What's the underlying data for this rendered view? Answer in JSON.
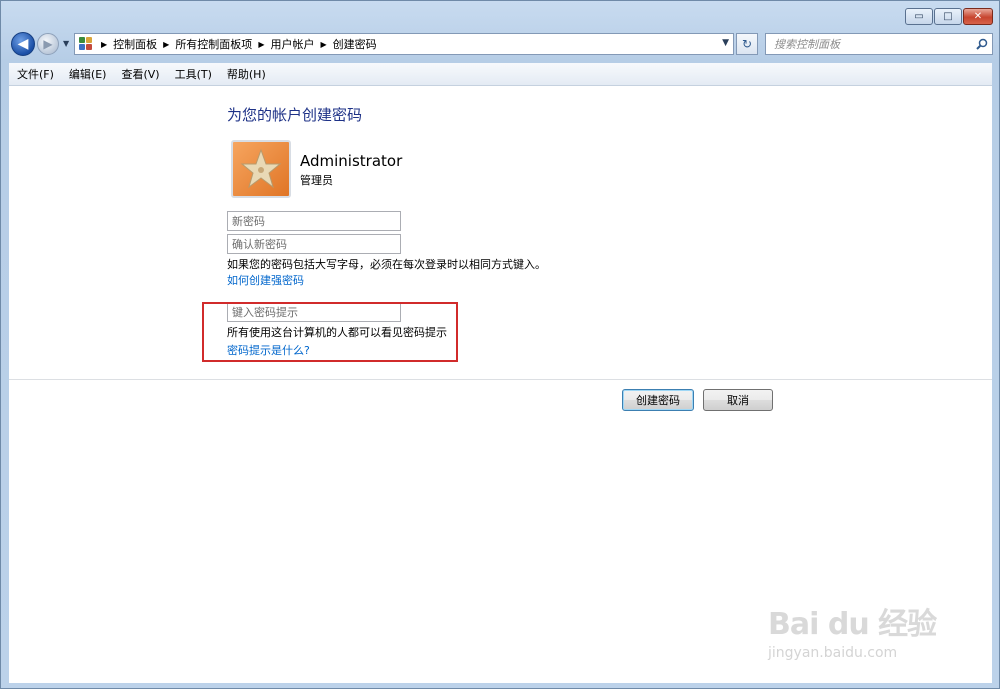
{
  "window": {
    "caption_buttons": {
      "minimize": "▭",
      "maximize": "□",
      "close": "✕"
    }
  },
  "address_bar": {
    "crumbs": [
      "控制面板",
      "所有控制面板项",
      "用户帐户",
      "创建密码"
    ],
    "separator": "▶"
  },
  "search": {
    "placeholder": "搜索控制面板"
  },
  "menu": {
    "items": [
      "文件(F)",
      "编辑(E)",
      "查看(V)",
      "工具(T)",
      "帮助(H)"
    ]
  },
  "main": {
    "title": "为您的帐户创建密码",
    "user": {
      "name": "Administrator",
      "role": "管理员"
    },
    "new_password_placeholder": "新密码",
    "confirm_password_placeholder": "确认新密码",
    "case_note": "如果您的密码包括大写字母，必须在每次登录时以相同方式键入。",
    "strong_password_link": "如何创建强密码",
    "hint_placeholder": "键入密码提示",
    "hint_note": "所有使用这台计算机的人都可以看见密码提示",
    "hint_link": "密码提示是什么?",
    "buttons": {
      "create": "创建密码",
      "cancel": "取消"
    }
  },
  "watermark": {
    "logo": "Bai du 经验",
    "url": "jingyan.baidu.com"
  },
  "colors": {
    "title": "#1e3287",
    "link": "#0066cc",
    "highlight_box": "#d12b2b"
  }
}
